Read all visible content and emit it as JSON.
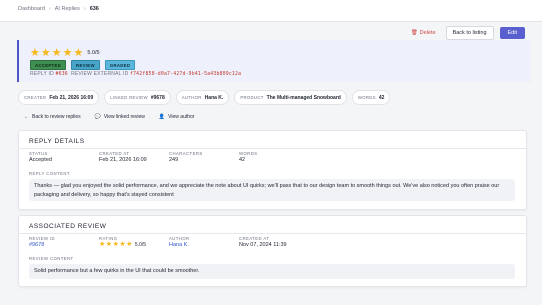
{
  "breadcrumb": {
    "items": [
      "Dashboard",
      "AI Replies",
      "636"
    ],
    "sep": "›"
  },
  "header": {
    "rating_value": "5.0/5",
    "stars": 5,
    "badges": [
      "ACCEPTED",
      "REVIEW",
      "GRADED"
    ],
    "reply_id_label": "REPLY ID",
    "reply_id": "#636",
    "ext_id_label": "REVIEW EXTERNAL ID",
    "ext_id": "f742f850-d0a7-427d-9b41-5a43b809c12a",
    "delete_label": "Delete",
    "back_label": "Back to listing",
    "edit_label": "Edit"
  },
  "pills": [
    {
      "k": "CREATED",
      "v": "Feb 21, 2026 16:09"
    },
    {
      "k": "LINKED REVIEW",
      "v": "#9678"
    },
    {
      "k": "AUTHOR",
      "v": "Hana K."
    },
    {
      "k": "PRODUCT",
      "v": "The Multi-managed Snowboard"
    },
    {
      "k": "WORDS",
      "v": "42"
    }
  ],
  "links": {
    "back_replies": "Back to review replies",
    "view_review": "View linked review",
    "view_author": "View author"
  },
  "reply_details": {
    "title": "REPLY DETAILS",
    "status_k": "STATUS",
    "status_v": "Accepted",
    "created_k": "CREATED AT",
    "created_v": "Feb 21, 2026 16:09",
    "chars_k": "CHARACTERS",
    "chars_v": "249",
    "words_k": "WORDS",
    "words_v": "42",
    "content_k": "REPLY CONTENT",
    "content": "Thanks — glad you enjoyed the solid performance, and we appreciate the note about UI quirks; we'll pass that to our design team to smooth things out. We've also noticed you often praise our packaging and delivery, so happy that's stayed consistent"
  },
  "associated_review": {
    "title": "ASSOCIATED REVIEW",
    "id_k": "REVIEW ID",
    "id_v": "#9678",
    "rating_k": "RATING",
    "rating_v": "5.0/5",
    "author_k": "AUTHOR",
    "author_v": "Hana K.",
    "created_k": "CREATED AT",
    "created_v": "Nov 07, 2024 11:39",
    "content_k": "REVIEW CONTENT",
    "content": "Solid performance but a few quirks in the UI that could be smoother."
  },
  "colors": {
    "accent": "#5a5fd0",
    "star": "#f5b81a",
    "danger": "#d04545",
    "link": "#2f55c9"
  },
  "icons": {
    "star": "star-icon",
    "trash": "trash-icon",
    "arrow-left": "arrow-left-icon",
    "chat": "chat-icon",
    "user": "user-icon"
  }
}
